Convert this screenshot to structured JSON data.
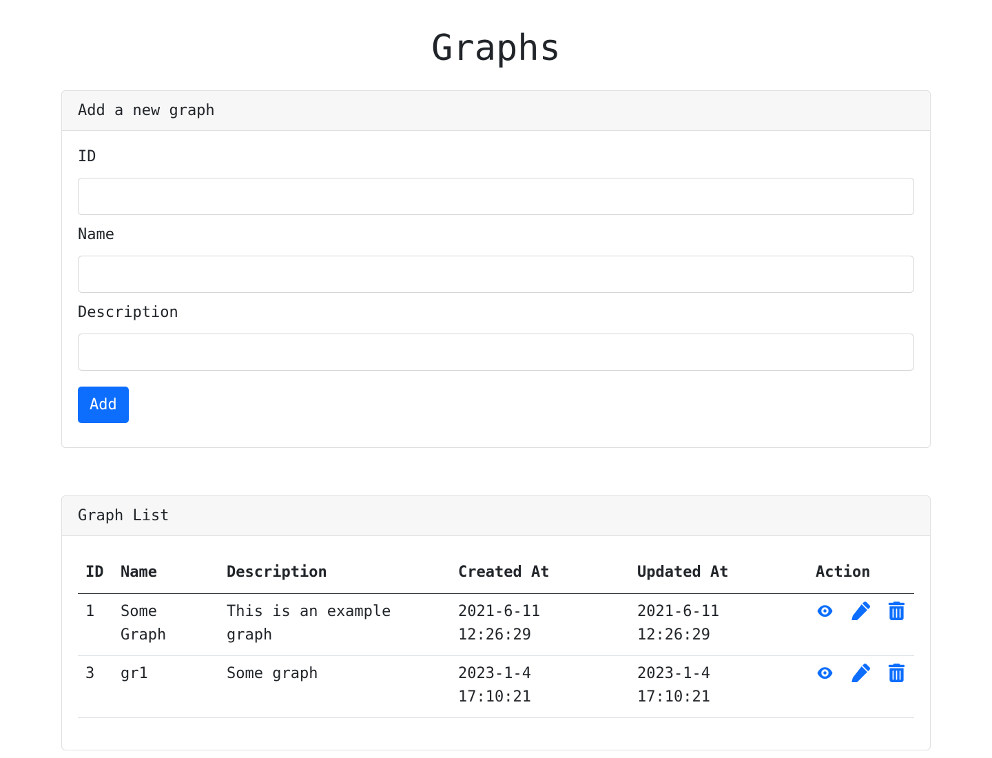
{
  "page": {
    "title": "Graphs"
  },
  "add_form": {
    "header": "Add a new graph",
    "fields": [
      {
        "label": "ID",
        "value": "",
        "placeholder": ""
      },
      {
        "label": "Name",
        "value": "",
        "placeholder": ""
      },
      {
        "label": "Description",
        "value": "",
        "placeholder": ""
      }
    ],
    "submit_label": "Add"
  },
  "graph_list": {
    "header": "Graph List",
    "columns": [
      "ID",
      "Name",
      "Description",
      "Created At",
      "Updated At",
      "Action"
    ],
    "rows": [
      {
        "id": "1",
        "name": "Some\nGraph",
        "description": "This is an example\ngraph",
        "created_at": "2021-6-11\n12:26:29",
        "updated_at": "2021-6-11\n12:26:29",
        "actions": [
          "eye-icon",
          "pencil-icon",
          "trash-icon"
        ]
      },
      {
        "id": "3",
        "name": "gr1",
        "description": "Some graph",
        "created_at": "2023-1-4\n17:10:21",
        "updated_at": "2023-1-4\n17:10:21",
        "actions": [
          "eye-icon",
          "pencil-icon",
          "trash-icon"
        ]
      }
    ]
  },
  "colors": {
    "accent": "#0d6efd",
    "text": "#212529",
    "header_bg": "#f7f7f7"
  }
}
